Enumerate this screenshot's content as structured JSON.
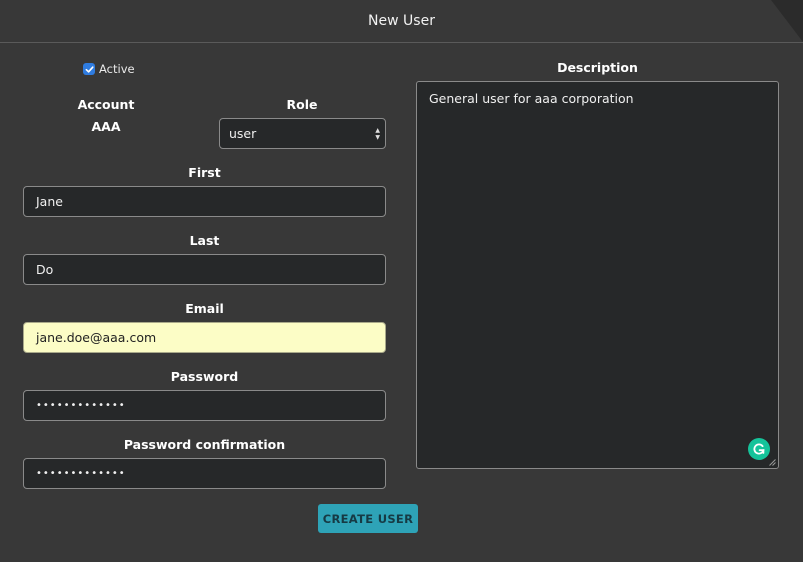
{
  "window": {
    "title": "New User"
  },
  "form": {
    "active_label": "Active",
    "active_checked": true,
    "account_label": "Account",
    "account_value": "AAA",
    "role_label": "Role",
    "role_value": "user",
    "first_label": "First",
    "first_value": "Jane",
    "last_label": "Last",
    "last_value": "Do",
    "email_label": "Email",
    "email_value": "jane.doe@aaa.com",
    "password_label": "Password",
    "password_value": "•••••••••••••",
    "password_confirmation_label": "Password confirmation",
    "password_confirmation_value": "•••••••••••••",
    "description_label": "Description",
    "description_value": "General user for aaa corporation",
    "submit_label": "CREATE USER"
  },
  "colors": {
    "background": "#383838",
    "input_background": "#262829",
    "autofill_background": "#fcfdc6",
    "checkbox": "#2f7ce0",
    "button": "#2ea3b7",
    "grammarly": "#15c39a"
  },
  "icons": {
    "checkbox": "check-icon",
    "select_arrows": "updown-arrows-icon",
    "grammarly": "grammarly-icon",
    "resize": "resize-handle-icon"
  }
}
